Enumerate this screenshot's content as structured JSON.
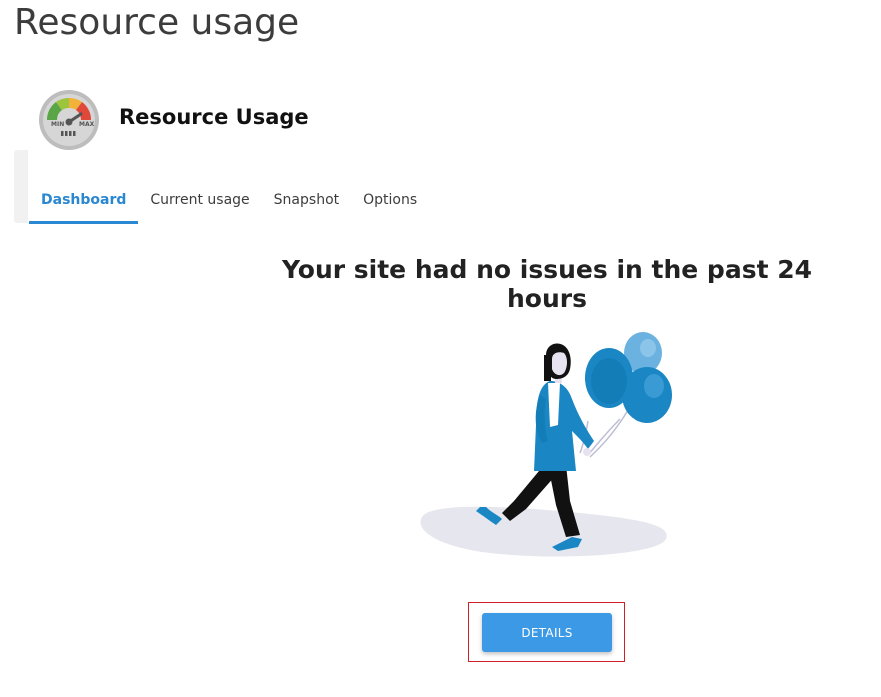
{
  "page": {
    "title": "Resource usage"
  },
  "app": {
    "name": "Resource Usage",
    "icon": "gauge-icon",
    "icon_labels": {
      "min": "MIN",
      "max": "MAX"
    }
  },
  "tabs": [
    {
      "label": "Dashboard",
      "active": true
    },
    {
      "label": "Current usage",
      "active": false
    },
    {
      "label": "Snapshot",
      "active": false
    },
    {
      "label": "Options",
      "active": false
    }
  ],
  "main": {
    "headline": "Your site had no issues in the past 24 hours",
    "illustration": "woman-with-balloons-illustration",
    "details_button_label": "DETAILS"
  },
  "colors": {
    "accent": "#2a87d1",
    "button": "#3c99e6",
    "balloon": "#1a87c4",
    "highlight": "#d0202a"
  }
}
